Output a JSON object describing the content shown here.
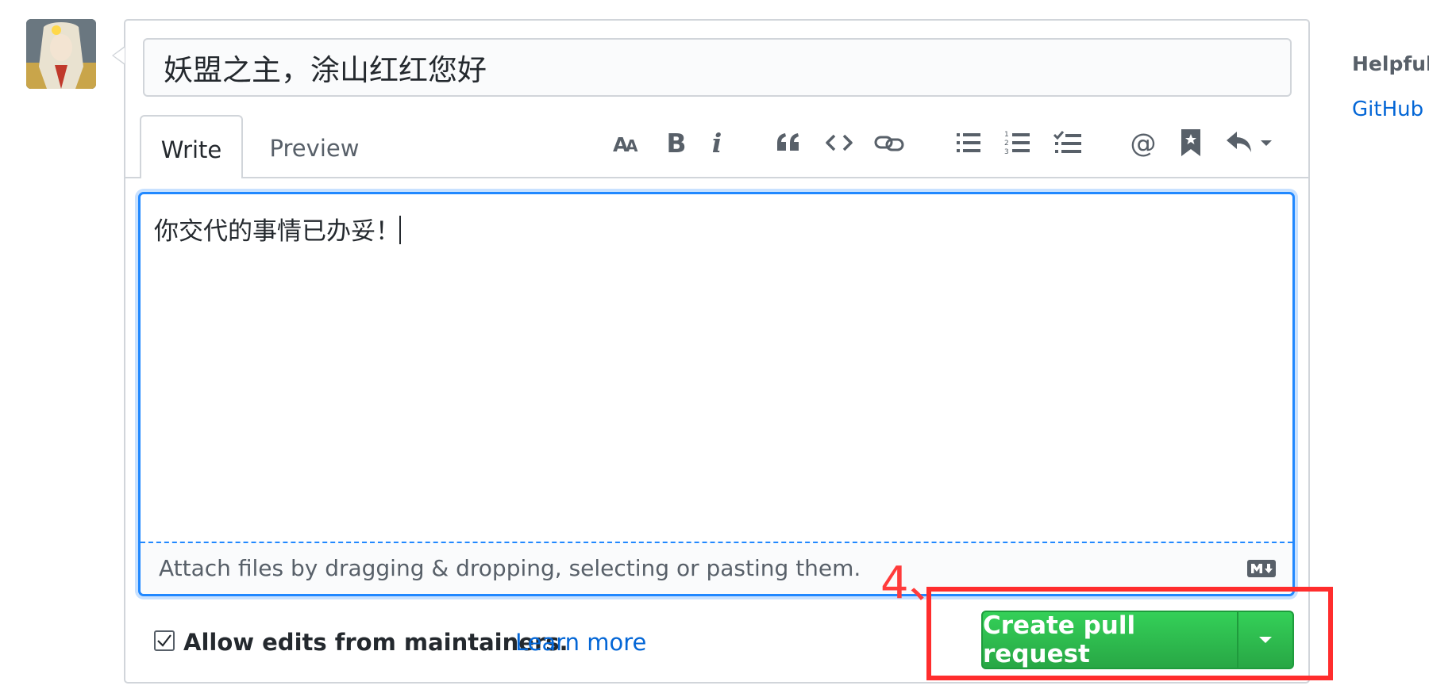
{
  "title_field": {
    "value": "妖盟之主，涂山红红您好"
  },
  "tabs": {
    "write": "Write",
    "preview": "Preview"
  },
  "toolbar": {
    "icons": [
      "text-size-icon",
      "bold-icon",
      "italic-icon",
      "quote-icon",
      "code-icon",
      "link-icon",
      "unordered-list-icon",
      "ordered-list-icon",
      "task-list-icon",
      "mention-icon",
      "saved-reply-icon",
      "reply-icon"
    ],
    "bold_glyph": "B",
    "italic_glyph": "i",
    "mention_glyph": "@"
  },
  "editor": {
    "body": "你交代的事情已办妥！"
  },
  "attach": {
    "text": "Attach files by dragging & dropping, selecting or pasting them."
  },
  "maintainers": {
    "label": "Allow edits from maintainers.",
    "checked": true,
    "learn_more": "Learn more"
  },
  "submit": {
    "label": "Create pull request"
  },
  "annotation": {
    "step": "4、"
  },
  "sidebar": {
    "title": "Helpful r",
    "link": "GitHub C"
  },
  "colors": {
    "accent_blue": "#2188ff",
    "link": "#0366d6",
    "button_green": "#28a745",
    "annotation_red": "#ff2d2d"
  }
}
